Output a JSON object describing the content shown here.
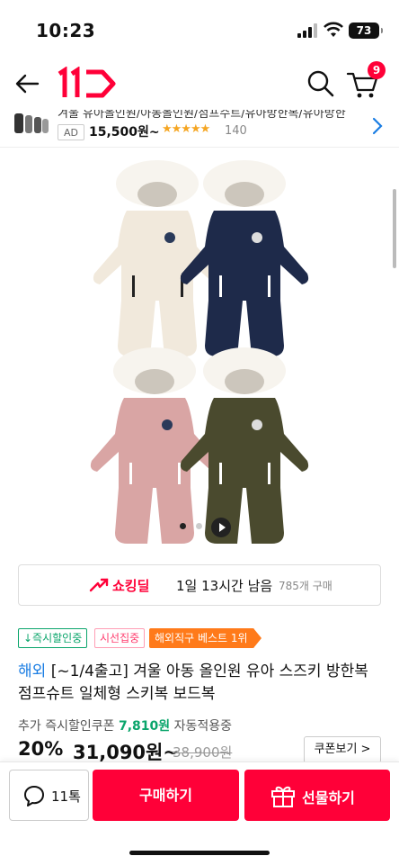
{
  "status_bar": {
    "time": "10:23",
    "battery": "73"
  },
  "header": {
    "logo_text": "11",
    "cart_count": "9"
  },
  "ad": {
    "title": "겨울 유아올인원/아동올인원/점프수트/유아방한복/유아방한",
    "badge": "AD",
    "price": "15,500원~",
    "stars": "★★★★★",
    "reviews": "140"
  },
  "product_image": {
    "colors": [
      "#f4ede4",
      "#1e2a4a",
      "#d9a5a4",
      "#4a4a2e"
    ],
    "slide_count": 2
  },
  "deal": {
    "label": "쇼킹딜",
    "time_left": "1일 13시간 남음",
    "sold": "785개 구매"
  },
  "tags": {
    "instant": "↓즉시할인중",
    "popular": "시선집중",
    "best": "해외직구 베스트 1위"
  },
  "product": {
    "origin": "해외",
    "title": "[~1/4출고] 겨울 아동 올인원 유아 스즈키 방한복 점프슈트 일체형 스키복 보드복",
    "coupon_prefix": "추가 즉시할인쿠폰",
    "coupon_amount": "7,810원",
    "coupon_suffix": "자동적용중",
    "discount": "20%",
    "price": "31,090원~",
    "original_price": "38,900원",
    "coupon_button": "쿠폰보기 >"
  },
  "bottom_bar": {
    "talk_label": "11톡",
    "buy_label": "구매하기",
    "gift_label": "선물하기"
  },
  "colors": {
    "brand": "#ff0038",
    "green": "#0aa56b",
    "orange": "#ff7a1a",
    "link": "#1a7de3"
  }
}
